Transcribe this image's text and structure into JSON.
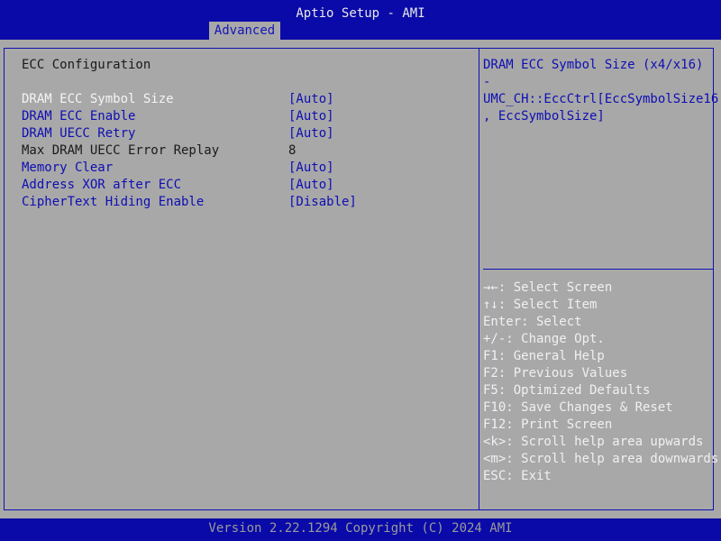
{
  "header": {
    "title": "Aptio Setup - AMI",
    "tab": "Advanced"
  },
  "main": {
    "section_title": "ECC Configuration",
    "settings": [
      {
        "label": "DRAM ECC Symbol Size",
        "value": "[Auto]"
      },
      {
        "label": "DRAM ECC Enable",
        "value": "[Auto]"
      },
      {
        "label": "DRAM UECC Retry",
        "value": "[Auto]"
      },
      {
        "label": "Max DRAM UECC Error Replay",
        "value": "8"
      },
      {
        "label": "Memory Clear",
        "value": "[Auto]"
      },
      {
        "label": "Address XOR after ECC",
        "value": "[Auto]"
      },
      {
        "label": "CipherText Hiding Enable",
        "value": "[Disable]"
      }
    ]
  },
  "help": {
    "lines": [
      "DRAM ECC Symbol Size (x4/x16)",
      "-",
      "UMC_CH::EccCtrl[EccSymbolSize16",
      ", EccSymbolSize]"
    ]
  },
  "keys": [
    "→←: Select Screen",
    "↑↓: Select Item",
    "Enter: Select",
    "+/-: Change Opt.",
    "F1: General Help",
    "F2: Previous Values",
    "F5: Optimized Defaults",
    "F10: Save Changes & Reset",
    "F12: Print Screen",
    "<k>: Scroll help area upwards",
    "<m>: Scroll help area downwards",
    "ESC: Exit"
  ],
  "footer": {
    "version": "Version 2.22.1294 Copyright (C) 2024 AMI"
  },
  "colors": {
    "header_bg": "#0a0aa8",
    "content_bg": "#a8a8a8",
    "selectable_text": "#0e0eb4",
    "selected_text": "#f4f4f4",
    "static_text": "#1a1a1a"
  }
}
